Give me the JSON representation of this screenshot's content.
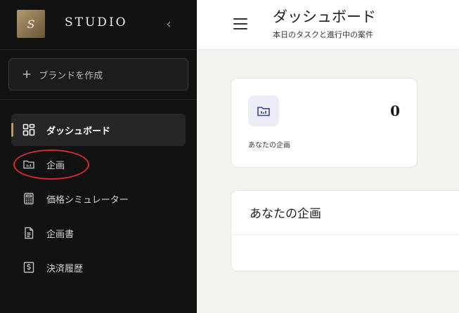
{
  "sidebar": {
    "logo_letter": "S",
    "brand_name": "STUDIO",
    "collapse_icon": "chevron-left-icon",
    "create_button": {
      "icon": "plus-icon",
      "label": "ブランドを作成"
    },
    "items": [
      {
        "label": "ダッシュボード",
        "icon": "grid-icon",
        "active": true
      },
      {
        "label": "企画",
        "icon": "folder-chart-icon",
        "active": false
      },
      {
        "label": "価格シミュレーター",
        "icon": "calculator-icon",
        "active": false
      },
      {
        "label": "企画書",
        "icon": "document-icon",
        "active": false
      },
      {
        "label": "決済履歴",
        "icon": "receipt-dollar-icon",
        "active": false
      }
    ]
  },
  "header": {
    "menu_icon": "hamburger-icon",
    "title": "ダッシュボード",
    "subtitle": "本日のタスクと進行中の案件"
  },
  "stats": {
    "icon": "folder-chart-icon",
    "value": "0",
    "label": "あなたの企画"
  },
  "projects_panel": {
    "title": "あなたの企画"
  },
  "colors": {
    "sidebar_bg": "#121212",
    "accent_gold": "#b8996a",
    "main_bg": "#f4f2ee",
    "annotation_red": "#d22b2b"
  }
}
